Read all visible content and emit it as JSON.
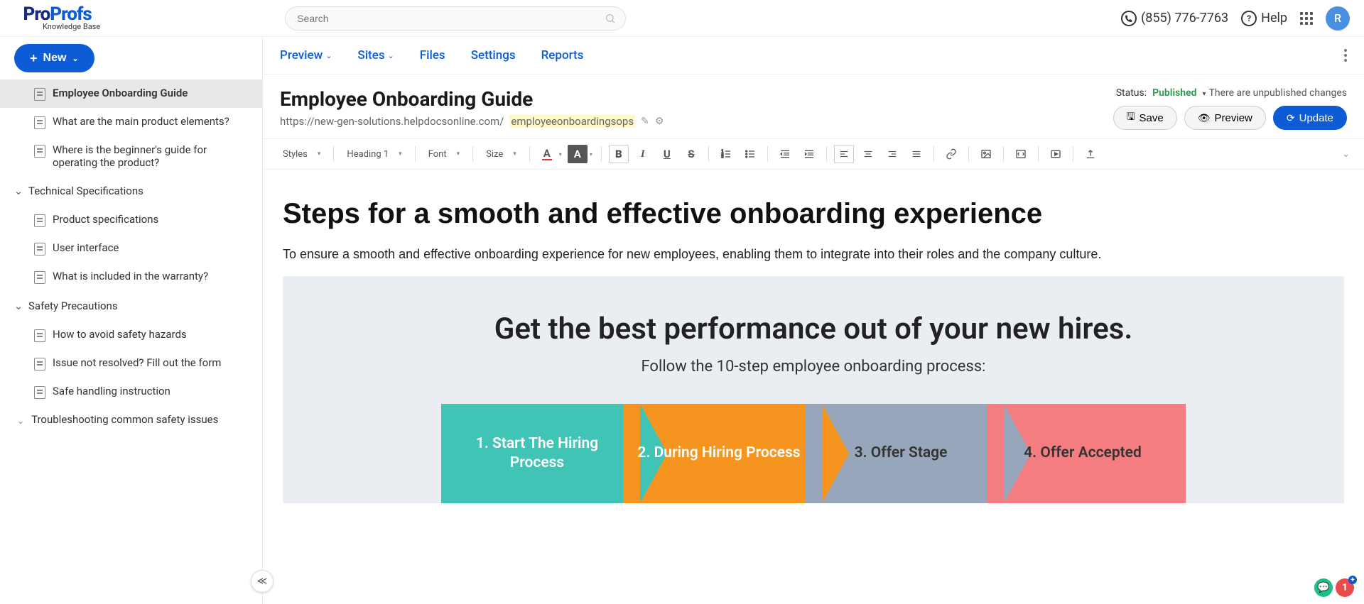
{
  "header": {
    "logo_primary": "Pro",
    "logo_secondary": "Profs",
    "logo_sub": "Knowledge Base",
    "search_placeholder": "Search",
    "phone": "(855) 776-7763",
    "help": "Help",
    "avatar_initial": "R"
  },
  "sidebar": {
    "new_button": "New",
    "items_top": [
      {
        "label": "Employee Onboarding Guide",
        "active": true
      },
      {
        "label": "What are the main product elements?"
      },
      {
        "label": "Where is the beginner's guide for operating the product?"
      }
    ],
    "groups": [
      {
        "label": "Technical Specifications",
        "items": [
          {
            "label": "Product specifications"
          },
          {
            "label": "User interface"
          },
          {
            "label": "What is included in the warranty?"
          }
        ]
      },
      {
        "label": "Safety Precautions",
        "items": [
          {
            "label": "How to avoid safety hazards"
          },
          {
            "label": "Issue not resolved? Fill out the form"
          },
          {
            "label": "Safe handling instruction"
          },
          {
            "label": "Troubleshooting common safety issues",
            "has_chevron": true
          }
        ]
      }
    ]
  },
  "menu": {
    "items": [
      "Preview",
      "Sites",
      "Files",
      "Settings",
      "Reports"
    ],
    "dropdowns": [
      true,
      true,
      false,
      false,
      false
    ]
  },
  "page": {
    "title": "Employee Onboarding Guide",
    "url_base": "https://new-gen-solutions.helpdocsonline.com/",
    "url_slug": "employeeonboardingsops",
    "status_label": "Status:",
    "status_value": "Published",
    "unpub_note": "There are unpublished changes",
    "save": "Save",
    "preview": "Preview",
    "update": "Update"
  },
  "editor_toolbar": {
    "styles": "Styles",
    "format": "Heading 1",
    "font": "Font",
    "size": "Size"
  },
  "document": {
    "heading": "Steps for a smooth and effective onboarding experience",
    "paragraph": "To ensure a smooth and effective onboarding experience for new employees, enabling them to integrate into their roles and the company culture.",
    "graphic": {
      "title": "Get the best performance out of your new hires.",
      "subtitle": "Follow the 10-step employee onboarding process:",
      "steps": [
        "1. Start The Hiring Process",
        "2. During Hiring Process",
        "3. Offer Stage",
        "4. Offer Accepted"
      ]
    }
  },
  "chat_badge_red": "1"
}
